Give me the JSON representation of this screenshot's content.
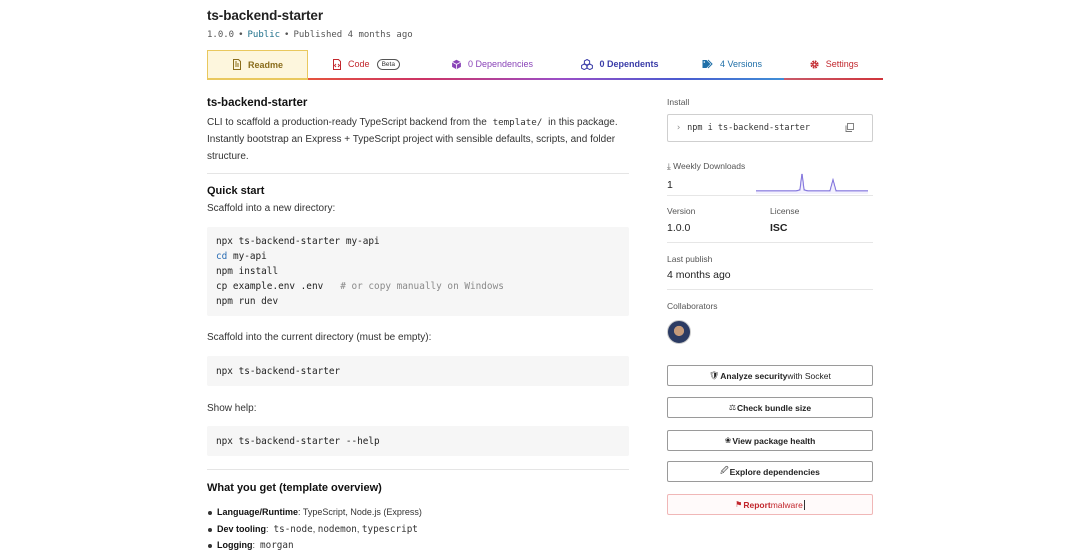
{
  "header": {
    "title": "ts-backend-starter",
    "version": "1.0.0",
    "visibility": "Public",
    "published": "Published 4 months ago",
    "separator": "•"
  },
  "tabs": [
    {
      "label": "Readme",
      "icon": "file-text-icon"
    },
    {
      "label": "Code",
      "icon": "file-code-icon",
      "badge": "Beta"
    },
    {
      "label": "0 Dependencies",
      "icon": "box-icon"
    },
    {
      "label": "0 Dependents",
      "icon": "boxes-icon"
    },
    {
      "label": "4 Versions",
      "icon": "tag-icon"
    },
    {
      "label": "Settings",
      "icon": "gear-icon"
    }
  ],
  "readme": {
    "title": "ts-backend-starter",
    "intro_1": "CLI to scaffold a production-ready TypeScript backend from the",
    "intro_code": "template/",
    "intro_2": "in this package. Instantly bootstrap an Express + TypeScript project with sensible defaults, scripts, and folder structure.",
    "quick_start_heading": "Quick start",
    "scaffold_new_text": "Scaffold into a new directory:",
    "code_new": [
      {
        "cmd": "npx ts-backend-starter my-api"
      },
      {
        "kw": "cd",
        "cmd": " my-api"
      },
      {
        "cmd": "npm install"
      },
      {
        "cmd": "cp example.env .env",
        "comment": "# or copy manually on Windows"
      },
      {
        "cmd": "npm run dev"
      }
    ],
    "scaffold_current_text": "Scaffold into the current directory (must be empty):",
    "code_current": "npx ts-backend-starter",
    "help_text": "Show help:",
    "code_help": "npx ts-backend-starter --help",
    "overview_heading": "What you get (template overview)",
    "features": [
      {
        "label": "Language/Runtime",
        "text": ": TypeScript, Node.js (Express)"
      },
      {
        "label": "Dev tooling",
        "codes": [
          "ts-node",
          "nodemon",
          "typescript"
        ]
      },
      {
        "label": "Logging",
        "codes": [
          "morgan"
        ]
      }
    ]
  },
  "sidebar": {
    "install_label": "Install",
    "install_command": "npm i ts-backend-starter",
    "weekly_downloads_label": "Weekly Downloads",
    "weekly_downloads_value": "1",
    "version_label": "Version",
    "version_value": "1.0.0",
    "license_label": "License",
    "license_value": "ISC",
    "last_publish_label": "Last publish",
    "last_publish_value": "4 months ago",
    "collaborators_label": "Collaborators",
    "actions": [
      {
        "glyph": "🛡",
        "bold": "Analyze security",
        "rest": " with Socket"
      },
      {
        "glyph": "⚖",
        "bold": "Check bundle size",
        "rest": ""
      },
      {
        "glyph": "❀",
        "bold": "View package health",
        "rest": ""
      },
      {
        "glyph": "🖉",
        "bold": "Explore dependencies",
        "rest": ""
      },
      {
        "glyph": "⚑",
        "bold": "Report",
        "rest": " malware"
      }
    ]
  },
  "colors": {
    "readme_tab_bg": "#fdf6dd",
    "readme_tab_border": "#e9c85e",
    "code_tab": "#c2272d",
    "deps_tab": "#8a44b8",
    "dependents_tab": "#3a3ca8",
    "versions_tab": "#1f6fa8",
    "sparkline": "#6b5bd6"
  }
}
